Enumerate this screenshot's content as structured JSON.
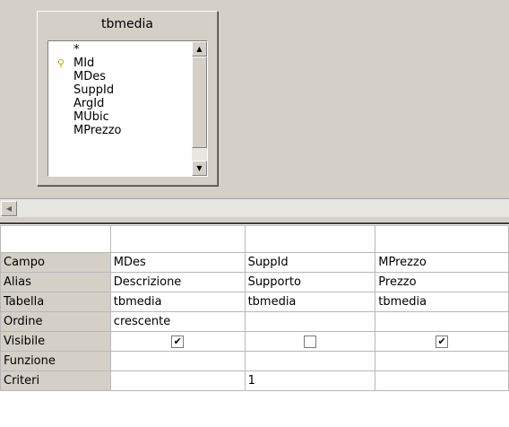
{
  "table": {
    "title": "tbmedia",
    "fields": [
      "*",
      "MId",
      "MDes",
      "SuppId",
      "ArgId",
      "MUbic",
      "MPrezzo"
    ],
    "primary_key": "MId"
  },
  "grid": {
    "row_labels": [
      "Campo",
      "Alias",
      "Tabella",
      "Ordine",
      "Visibile",
      "Funzione",
      "Criteri"
    ],
    "columns": [
      {
        "campo": "MDes",
        "alias": "Descrizione",
        "tabella": "tbmedia",
        "ordine": "crescente",
        "visibile": true,
        "funzione": "",
        "criteri": ""
      },
      {
        "campo": "SuppId",
        "alias": "Supporto",
        "tabella": "tbmedia",
        "ordine": "",
        "visibile": false,
        "funzione": "",
        "criteri": "1"
      },
      {
        "campo": "MPrezzo",
        "alias": "Prezzo",
        "tabella": "tbmedia",
        "ordine": "",
        "visibile": true,
        "funzione": "",
        "criteri": ""
      }
    ]
  },
  "icons": {
    "key": "key-icon",
    "scroll_up": "scroll-up-icon",
    "scroll_down": "scroll-down-icon",
    "scroll_left": "scroll-left-icon"
  }
}
